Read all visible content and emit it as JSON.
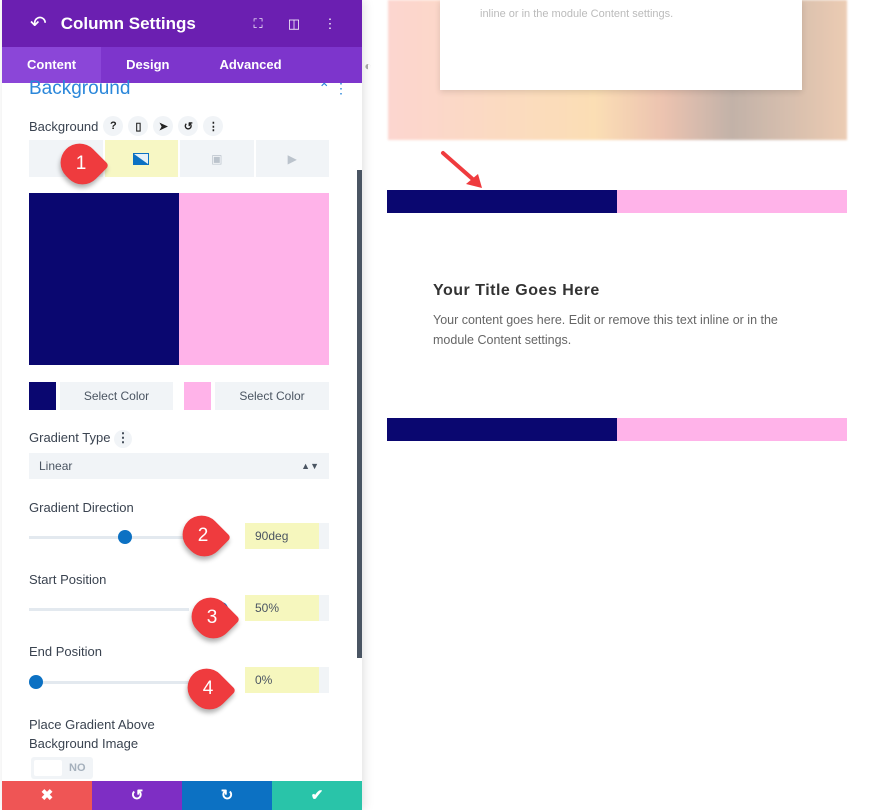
{
  "header": {
    "title": "Column Settings",
    "back_icon": "undo-arrow",
    "icons": [
      "expand-icon",
      "sidebar-layout-icon",
      "more-icon"
    ]
  },
  "tabs": [
    {
      "label": "Content"
    },
    {
      "label": "Design"
    },
    {
      "label": "Advanced"
    }
  ],
  "section": {
    "title": "Background"
  },
  "background": {
    "label": "Background",
    "help": "?",
    "more": "⋮"
  },
  "gradient": {
    "color1": "#0a0770",
    "color2": "#ffb3e9",
    "select1": "Select Color",
    "select2": "Select Color"
  },
  "gradient_type": {
    "label": "Gradient Type",
    "value": "Linear"
  },
  "direction": {
    "label": "Gradient Direction",
    "value": "90deg",
    "fraction": 0.25
  },
  "start": {
    "label": "Start Position",
    "value": "50%",
    "fraction": 0.5
  },
  "end": {
    "label": "End Position",
    "value": "0%",
    "fraction": 0
  },
  "place_above": {
    "label": "Place Gradient Above Background Image",
    "toggle": "NO"
  },
  "callouts": [
    "1",
    "2",
    "3",
    "4"
  ],
  "footer": {
    "cancel": "✖",
    "undo": "↺",
    "redo": "↻",
    "save": "✔"
  },
  "preview": {
    "blurred_text": "inline or in the module Content settings.",
    "module_title": "Your Title Goes Here",
    "module_text": "Your content goes here. Edit or remove this text inline or in the module Content settings."
  }
}
